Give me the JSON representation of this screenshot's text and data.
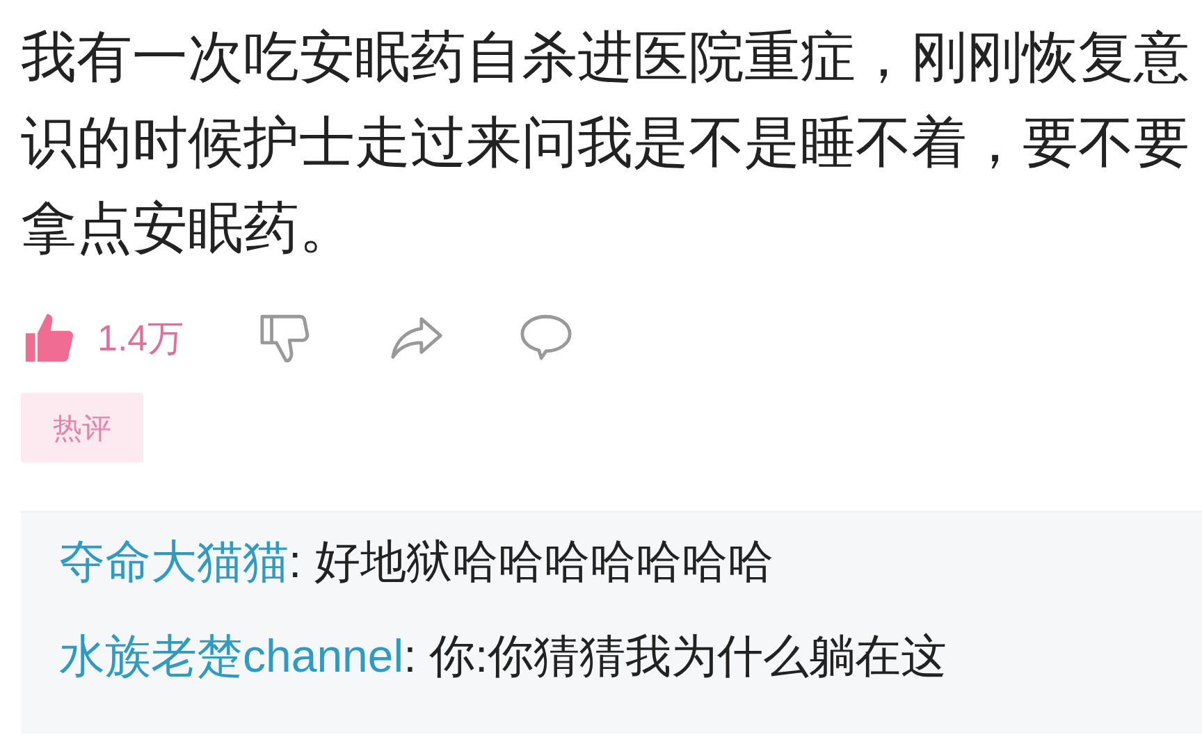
{
  "comment": {
    "text": "我有一次吃安眠药自杀进医院重症，刚刚恢复意识的时候护士走过来问我是不是睡不着，要不要拿点安眠药。"
  },
  "actions": {
    "like": {
      "count": "1.4万",
      "selected": true
    }
  },
  "tag": "热评",
  "replies": [
    {
      "user": "夺命大猫猫",
      "text": ": 好地狱哈哈哈哈哈哈哈"
    },
    {
      "user": "水族老楚channel",
      "text": ": 你:你猜猜我为什么躺在这"
    }
  ]
}
